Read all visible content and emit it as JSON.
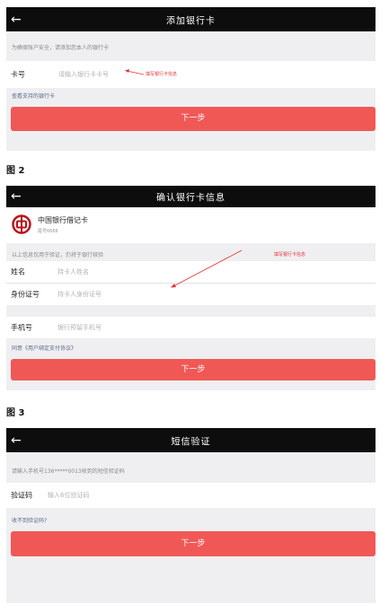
{
  "screen1": {
    "back_icon": "arrow-left-icon",
    "title": "添加银行卡",
    "hint": "为确保账户安全，请添加您本人的银行卡",
    "card_label": "卡号",
    "card_placeholder": "请输入银行卡卡号",
    "annotation": "填写银行卡信息",
    "supported_link": "查看支持的银行卡",
    "next_button": "下一步"
  },
  "fig2_label": "图 2",
  "screen2": {
    "back_icon": "arrow-left-icon",
    "title": "确认银行卡信息",
    "bank_logo": "bank-of-china-logo",
    "bank_name": "中国银行借记卡",
    "card_tail": "尾号6666",
    "hint": "以上信息仅用于验证，仍将于银行核验",
    "annotation": "填写银行卡信息",
    "name_label": "姓名",
    "name_placeholder": "持卡人姓名",
    "id_label": "身份证号",
    "id_placeholder": "持卡人身份证号",
    "phone_label": "手机号",
    "phone_placeholder": "银行预留手机号",
    "agreement": "同意《用户绑定支付协议》",
    "next_button": "下一步"
  },
  "fig3_label": "图 3",
  "screen3": {
    "back_icon": "arrow-left-icon",
    "title": "短信验证",
    "hint": "请输入手机号136*****0013收到的短信验证码",
    "code_label": "验证码",
    "code_placeholder": "输入6位验证码",
    "no_code_link": "收不到验证码?",
    "next_button": "下一步"
  },
  "colors": {
    "top_bar": "#0d0d0d",
    "page_bg": "#efeff1",
    "button": "#f05856",
    "annotation": "#e63232"
  }
}
